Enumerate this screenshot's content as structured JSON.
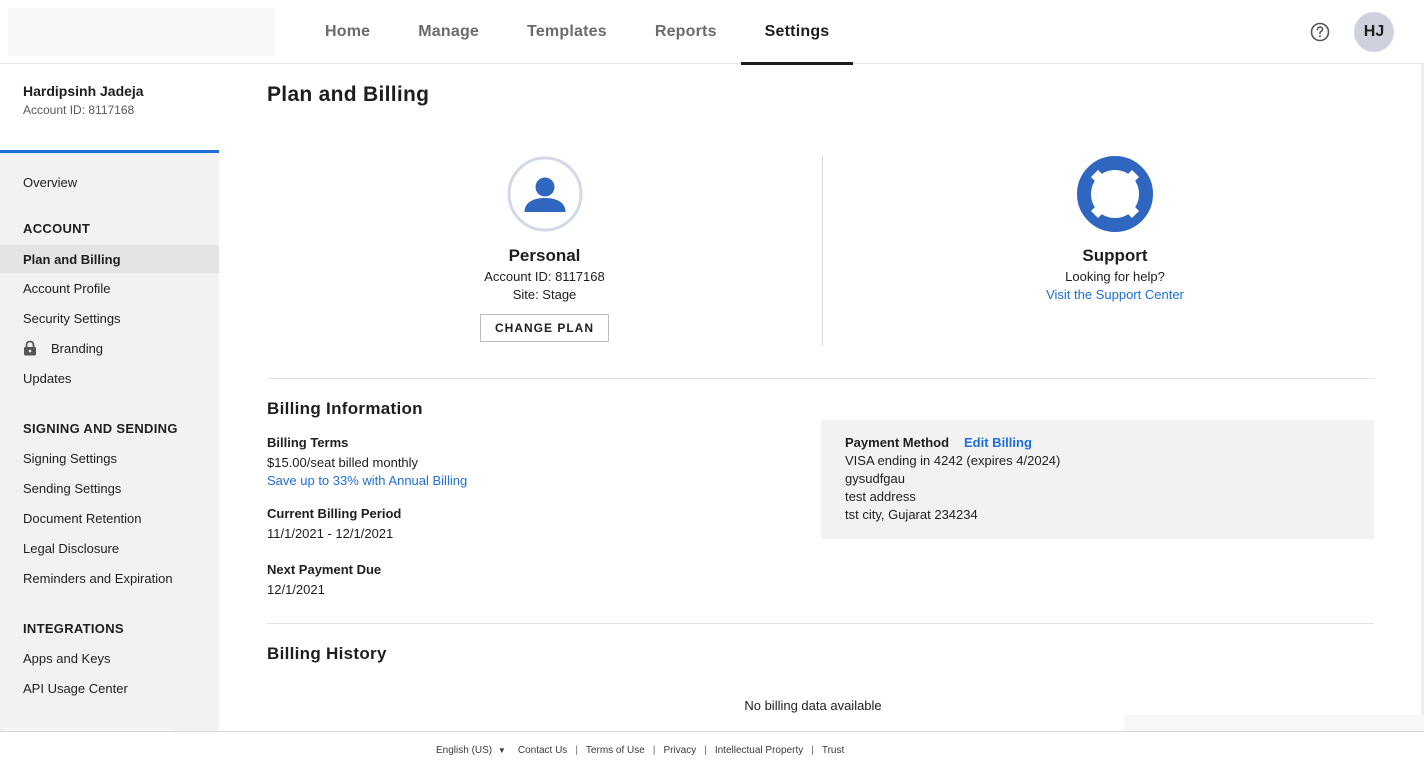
{
  "nav": {
    "items": [
      {
        "label": "Home"
      },
      {
        "label": "Manage"
      },
      {
        "label": "Templates"
      },
      {
        "label": "Reports"
      },
      {
        "label": "Settings"
      }
    ],
    "active": "Settings",
    "avatar_initials": "HJ",
    "help_icon": "question-circle-icon"
  },
  "sidebar": {
    "user_name": "Hardipsinh Jadeja",
    "account_id": "Account ID: 8117168",
    "overview": "Overview",
    "account_section": "ACCOUNT",
    "account_items": [
      "Plan and Billing",
      "Account Profile",
      "Security Settings",
      "Branding",
      "Updates"
    ],
    "signing_section": "SIGNING AND SENDING",
    "signing_items": [
      "Signing Settings",
      "Sending Settings",
      "Document Retention",
      "Legal Disclosure",
      "Reminders and Expiration"
    ],
    "integrations_section": "INTEGRATIONS",
    "integrations_items": [
      "Apps and Keys",
      "API Usage Center"
    ],
    "active_item": "Plan and Billing",
    "locked_item_icon": "lock-icon"
  },
  "main": {
    "title": "Plan and Billing",
    "personal": {
      "icon": "person-icon",
      "title": "Personal",
      "account_id": "Account ID: 8117168",
      "site": "Site: Stage",
      "change_plan": "CHANGE PLAN"
    },
    "support": {
      "icon": "lifebuoy-icon",
      "title": "Support",
      "text": "Looking for help?",
      "link": "Visit the Support Center"
    },
    "billing_info": {
      "title": "Billing Information",
      "terms_label": "Billing Terms",
      "terms_value": "$15.00/seat billed monthly",
      "annual_link": "Save up to 33% with Annual Billing",
      "period_label": "Current Billing Period",
      "period_value": "11/1/2021 - 12/1/2021",
      "next_label": "Next Payment Due",
      "next_value": "12/1/2021",
      "payment_label": "Payment Method",
      "edit_billing": "Edit Billing",
      "payment_lines": [
        "VISA ending in 4242 (expires 4/2024)",
        "gysudfgau",
        "test address",
        "tst city, Gujarat 234234"
      ]
    },
    "billing_history": {
      "title": "Billing History",
      "empty": "No billing data available"
    }
  },
  "footer": {
    "language": "English (US)",
    "links": [
      "Contact Us",
      "Terms of Use",
      "Privacy",
      "Intellectual Property",
      "Trust"
    ]
  },
  "colors": {
    "accent_blue": "#1f6fd6",
    "icon_blue": "#2f66c0",
    "avatar_bg": "#cfd2dc",
    "sidebar_bg": "#f2f2f2"
  }
}
